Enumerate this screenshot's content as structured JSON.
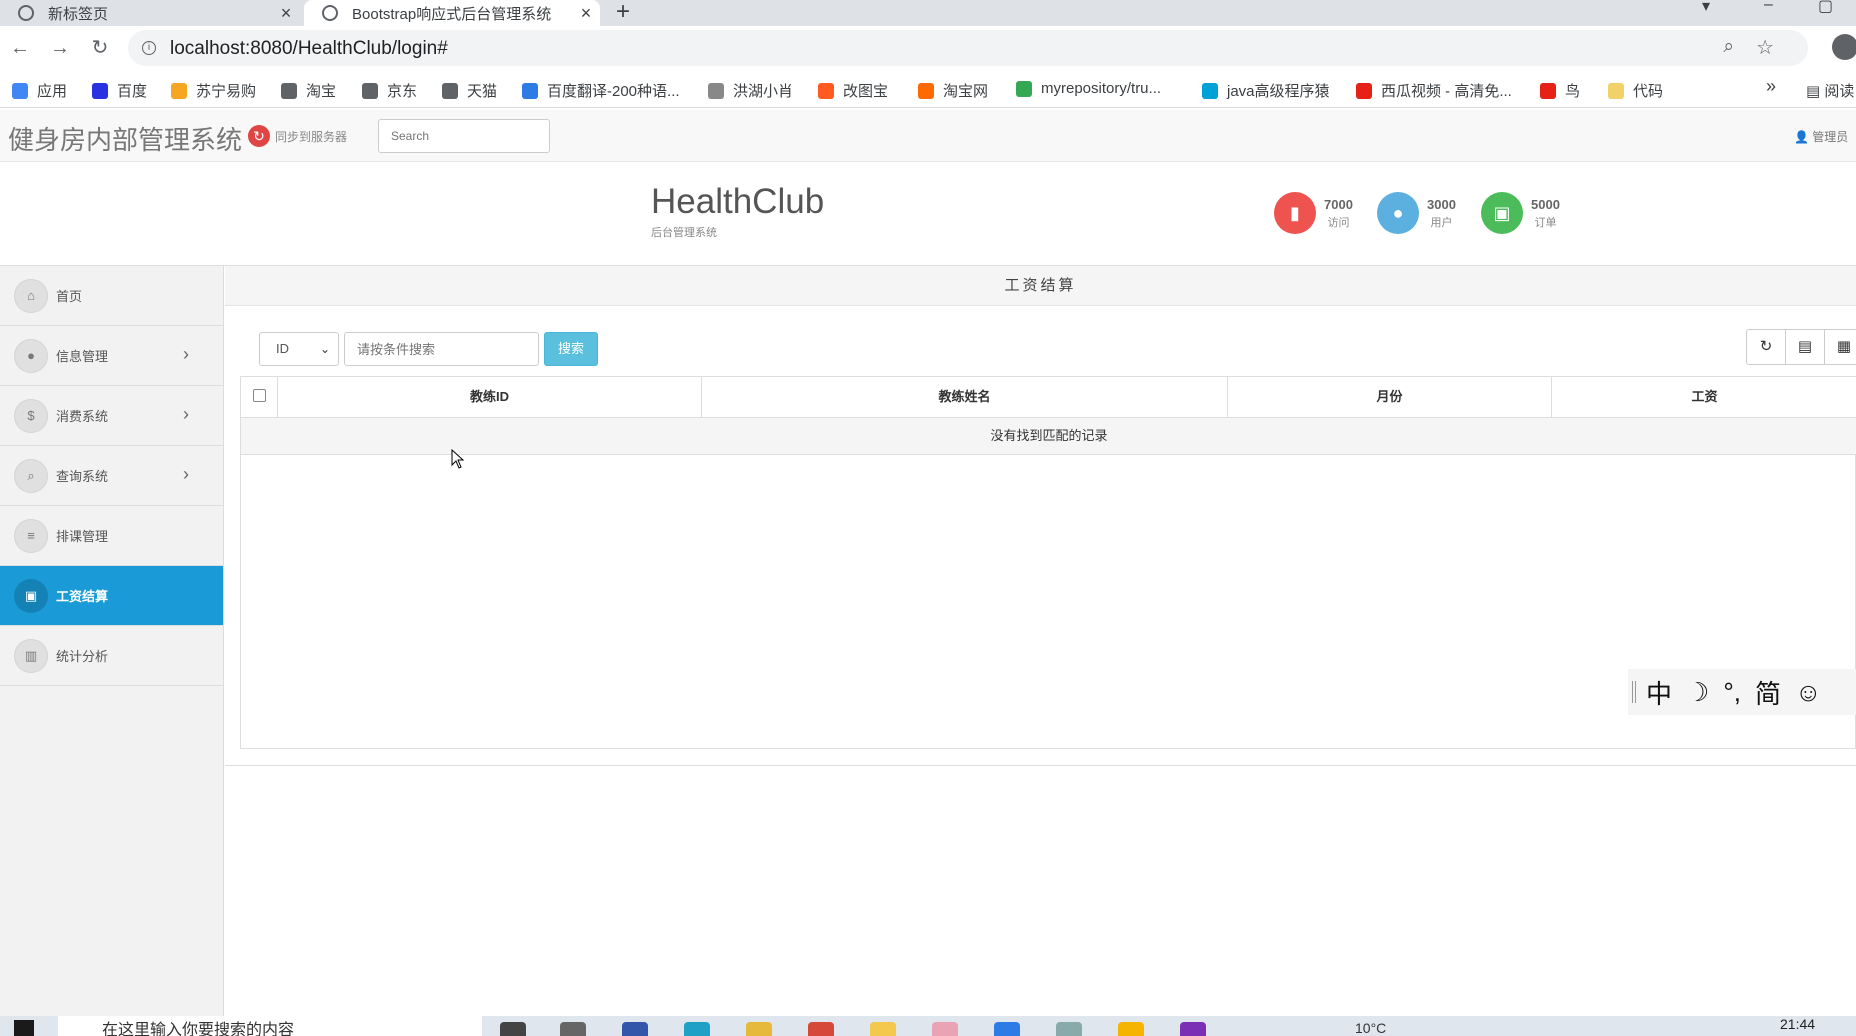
{
  "browser": {
    "tabs": [
      {
        "title": "新标签页"
      },
      {
        "title": "Bootstrap响应式后台管理系统"
      }
    ],
    "url": "localhost:8080/HealthClub/login#",
    "bookmarks": [
      {
        "label": "应用",
        "color": "#4285f4"
      },
      {
        "label": "百度",
        "color": "#2932e1"
      },
      {
        "label": "苏宁易购",
        "color": "#f5a623"
      },
      {
        "label": "淘宝",
        "color": "#5f6368"
      },
      {
        "label": "京东",
        "color": "#5f6368"
      },
      {
        "label": "天猫",
        "color": "#5f6368"
      },
      {
        "label": "百度翻译-200种语...",
        "color": "#2d7be5"
      },
      {
        "label": "洪湖小肖",
        "color": "#888888"
      },
      {
        "label": "改图宝",
        "color": "#ff5a1f"
      },
      {
        "label": "淘宝网",
        "color": "#ff6a00"
      },
      {
        "label": "myrepository/tru...",
        "color": "#34a853"
      },
      {
        "label": "java高级程序猿",
        "color": "#00a1d6"
      },
      {
        "label": "西瓜视频 - 高清免...",
        "color": "#e62117"
      },
      {
        "label": "鸟",
        "color": "#e62117"
      },
      {
        "label": "代码",
        "color": "#f2d16b"
      }
    ],
    "bookmarks_more": "»",
    "reading_list": "阅读"
  },
  "header": {
    "brand": "健身房内部管理系统",
    "sync_label": "同步到服务器",
    "search_placeholder": "Search",
    "user_label": "管理员"
  },
  "banner": {
    "title": "HealthClub",
    "subtitle": "后台管理系统",
    "stats": [
      {
        "value": "7000",
        "label": "访问",
        "color": "#ef5350",
        "icon": "signal-icon"
      },
      {
        "value": "3000",
        "label": "用户",
        "color": "#5bb0e0",
        "icon": "user-icon"
      },
      {
        "value": "5000",
        "label": "订单",
        "color": "#4cbb5a",
        "icon": "money-icon"
      }
    ]
  },
  "sidebar": {
    "items": [
      {
        "label": "首页",
        "icon": "home-icon",
        "has_submenu": false,
        "active": false
      },
      {
        "label": "信息管理",
        "icon": "user-icon",
        "has_submenu": true,
        "active": false
      },
      {
        "label": "消费系统",
        "icon": "dollar-icon",
        "has_submenu": true,
        "active": false
      },
      {
        "label": "查询系统",
        "icon": "search-icon",
        "has_submenu": true,
        "active": false
      },
      {
        "label": "排课管理",
        "icon": "list-icon",
        "has_submenu": false,
        "active": false
      },
      {
        "label": "工资结算",
        "icon": "money-icon",
        "has_submenu": false,
        "active": true
      },
      {
        "label": "统计分析",
        "icon": "chart-icon",
        "has_submenu": false,
        "active": false
      }
    ]
  },
  "main": {
    "panel_title": "工资结算",
    "search": {
      "select_value": "ID",
      "input_placeholder": "请按条件搜索",
      "button_label": "搜索"
    },
    "table": {
      "columns": [
        "教练ID",
        "教练姓名",
        "月份",
        "工资"
      ],
      "empty_message": "没有找到匹配的记录"
    }
  },
  "ime": {
    "items": [
      "中",
      "☽",
      "°,",
      "简",
      "☺"
    ]
  },
  "taskbar": {
    "search_placeholder": "在这里输入你要搜索的内容",
    "temperature": "10°C",
    "time": "21:44"
  }
}
